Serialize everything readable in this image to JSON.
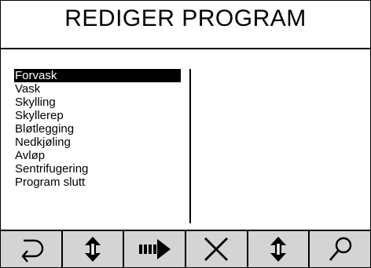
{
  "header": {
    "title": "REDIGER PROGRAM"
  },
  "steps": {
    "items": [
      "Forvask",
      "Vask",
      "Skylling",
      "Skyllerep",
      "Bløtlegging",
      "Nedkjøling",
      "Avløp",
      "Sentrifugering",
      "Program slutt"
    ],
    "selected_index": 0
  },
  "toolbar": {
    "buttons": [
      {
        "icon": "return-icon"
      },
      {
        "icon": "move-up-down-icon"
      },
      {
        "icon": "insert-arrow-icon"
      },
      {
        "icon": "delete-x-icon"
      },
      {
        "icon": "scroll-up-down-icon"
      },
      {
        "icon": "magnifier-icon"
      }
    ]
  },
  "colors": {
    "background": "#ffffff",
    "foreground": "#000000",
    "toolbar_button": "#d4d4d4",
    "selection": "#000000"
  }
}
